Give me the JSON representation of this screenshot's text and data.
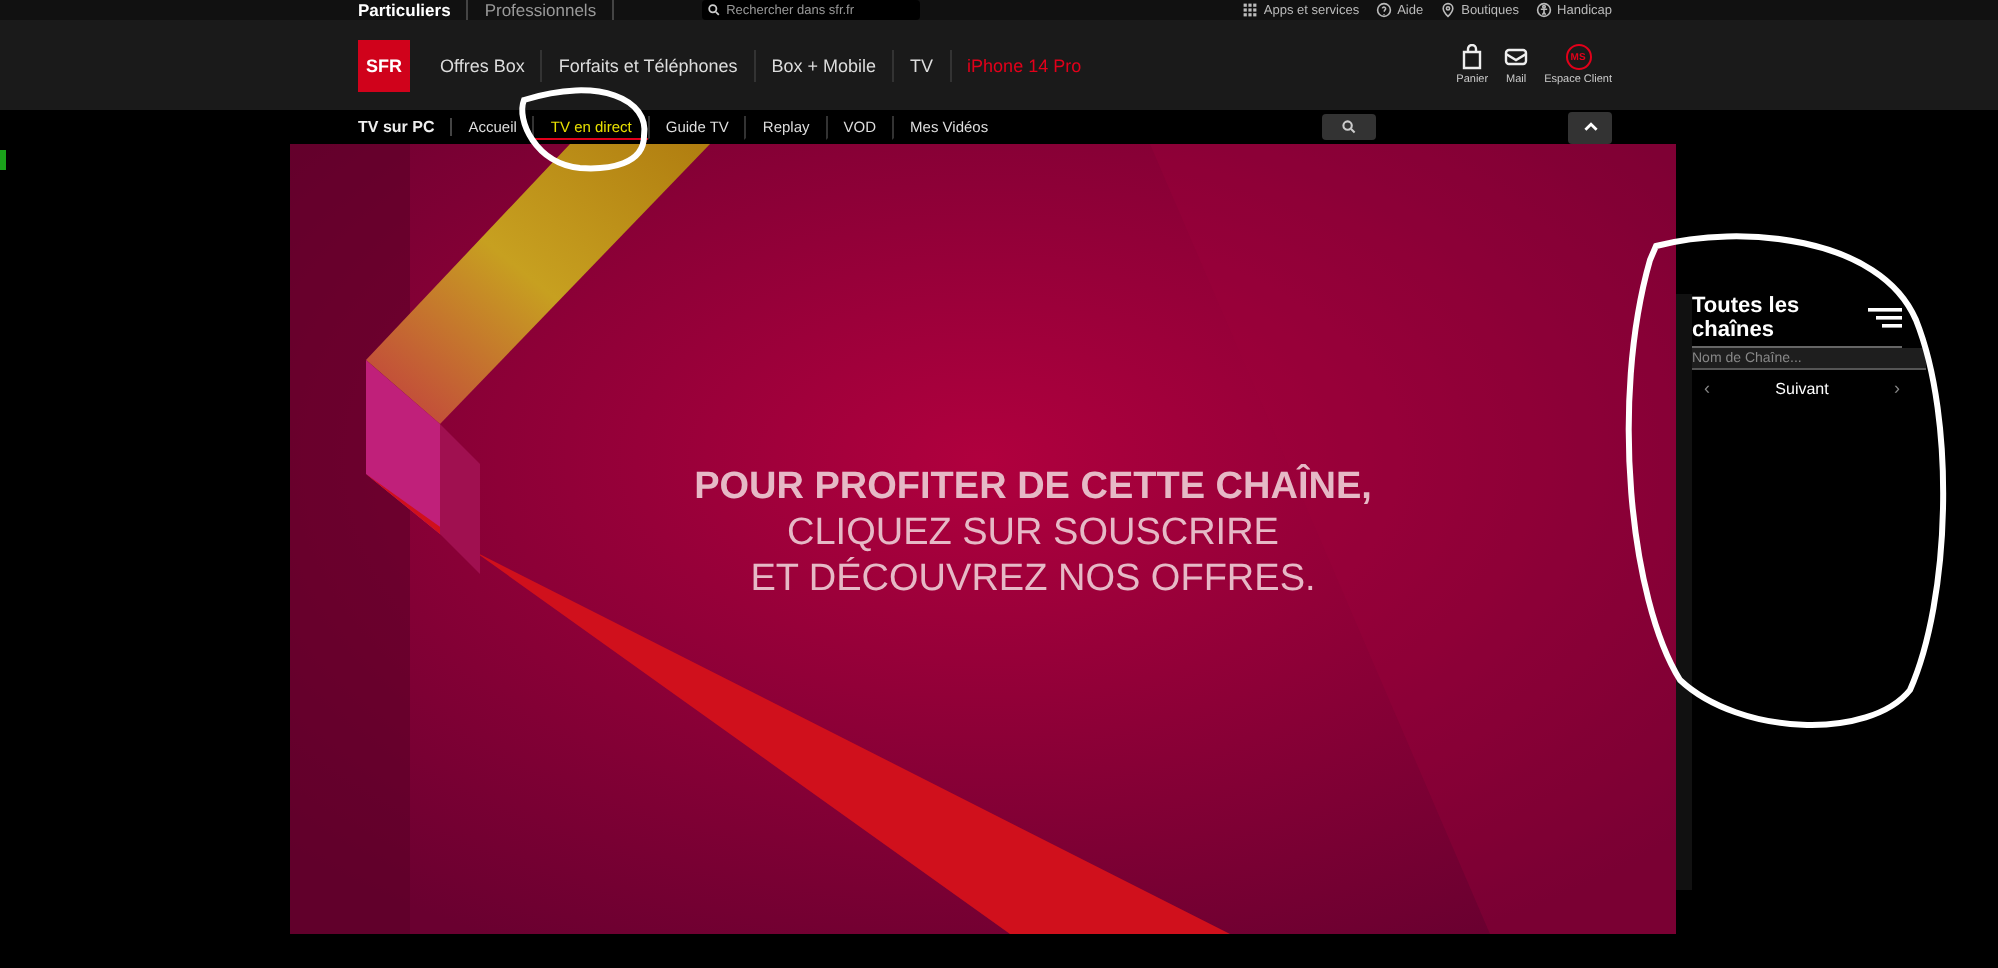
{
  "top_bar": {
    "segments": [
      {
        "label": "Particuliers",
        "selected": true
      },
      {
        "label": "Professionnels",
        "selected": false
      }
    ],
    "search": {
      "placeholder": "Rechercher dans sfr.fr"
    },
    "links": [
      {
        "label": "Apps et services"
      },
      {
        "label": "Aide"
      },
      {
        "label": "Boutiques"
      },
      {
        "label": "Handicap"
      }
    ]
  },
  "header": {
    "logo": "SFR",
    "nav": [
      {
        "label": "Offres Box",
        "kind": "normal"
      },
      {
        "label": "Forfaits et Téléphones",
        "kind": "normal"
      },
      {
        "label": "Box + Mobile",
        "kind": "normal"
      },
      {
        "label": "TV",
        "kind": "normal"
      },
      {
        "label": "iPhone 14 Pro",
        "kind": "promo"
      }
    ],
    "actions": [
      {
        "label": "Panier"
      },
      {
        "label": "Mail"
      },
      {
        "label": "Espace Client",
        "avatar": "MS"
      }
    ]
  },
  "sub_nav": {
    "title": "TV sur PC",
    "items": [
      {
        "label": "Accueil",
        "selected": false
      },
      {
        "label": "TV en direct",
        "selected": true
      },
      {
        "label": "Guide TV",
        "selected": false
      },
      {
        "label": "Replay",
        "selected": false
      },
      {
        "label": "VOD",
        "selected": false
      },
      {
        "label": "Mes Vidéos",
        "selected": false
      }
    ]
  },
  "player": {
    "kind": "picture",
    "message": [
      {
        "text": "POUR PROFITER DE CETTE CHAÎNE,",
        "bold": true
      },
      {
        "text": "CLIQUEZ SUR SOUSCRIRE",
        "bold": false
      },
      {
        "text": "ET DÉCOUVREZ NOS OFFRES.",
        "bold": false
      }
    ]
  },
  "channels_panel": {
    "title": "Toutes les chaînes",
    "search": {
      "placeholder": "Nom de Chaîne..."
    },
    "prev": "‹",
    "next_label": "Suivant",
    "next": "›"
  }
}
